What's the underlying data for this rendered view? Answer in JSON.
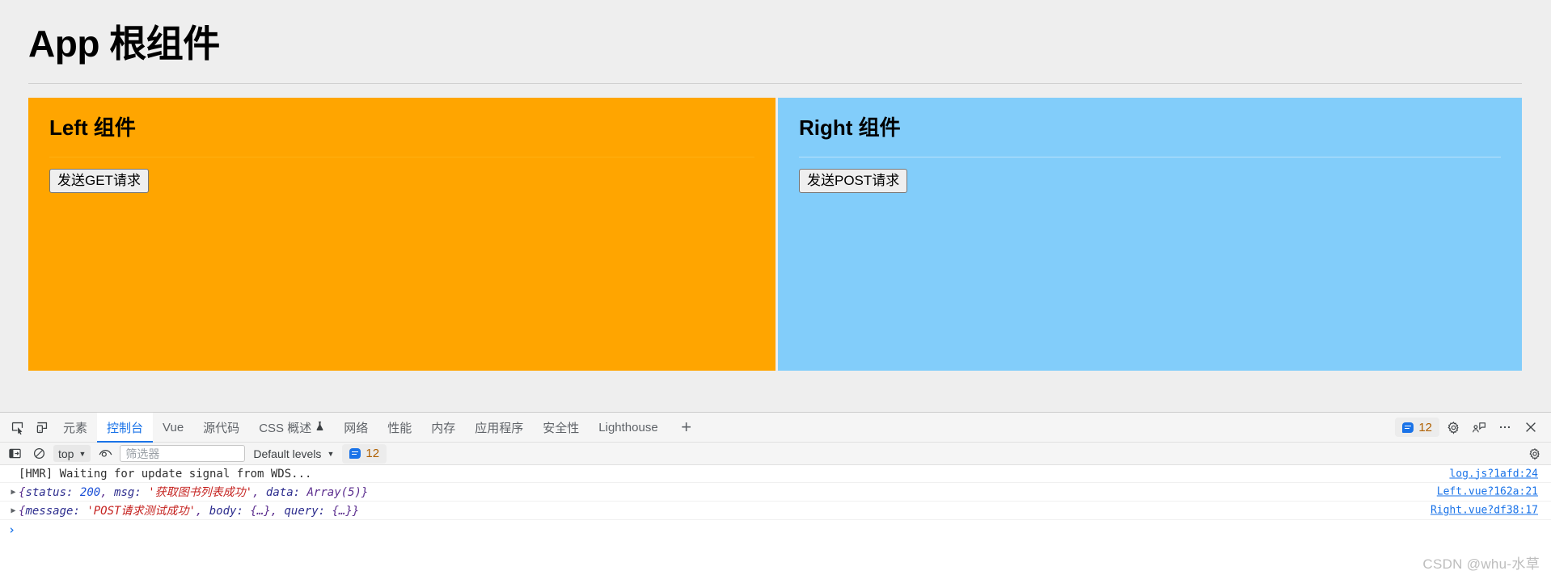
{
  "page": {
    "title": "App 根组件",
    "left_panel": {
      "heading": "Left 组件",
      "button_label": "发送GET请求",
      "bg_color": "#ffa500"
    },
    "right_panel": {
      "heading": "Right 组件",
      "button_label": "发送POST请求",
      "bg_color": "#82cdfa"
    }
  },
  "devtools": {
    "tabs": [
      {
        "label": "元素",
        "active": false,
        "icon": ""
      },
      {
        "label": "控制台",
        "active": true,
        "icon": ""
      },
      {
        "label": "Vue",
        "active": false,
        "icon": ""
      },
      {
        "label": "源代码",
        "active": false,
        "icon": ""
      },
      {
        "label": "CSS 概述",
        "active": false,
        "icon": "beaker-icon"
      },
      {
        "label": "网络",
        "active": false,
        "icon": ""
      },
      {
        "label": "性能",
        "active": false,
        "icon": ""
      },
      {
        "label": "内存",
        "active": false,
        "icon": ""
      },
      {
        "label": "应用程序",
        "active": false,
        "icon": ""
      },
      {
        "label": "安全性",
        "active": false,
        "icon": ""
      },
      {
        "label": "Lighthouse",
        "active": false,
        "icon": ""
      }
    ],
    "add_tab_label": "+",
    "message_badge_count": "12",
    "accent_color": "#1a73e8",
    "console_toolbar": {
      "context": "top",
      "filter_placeholder": "筛选器",
      "filter_value": "",
      "levels": "Default levels",
      "badge_count": "12"
    },
    "console_logs": [
      {
        "expandable": false,
        "text": "[HMR] Waiting for update signal from WDS...",
        "source": "log.js?1afd:24",
        "tokens": []
      },
      {
        "expandable": true,
        "text": "{status: 200, msg: '获取图书列表成功', data: Array(5)}",
        "source": "Left.vue?162a:21",
        "tokens": [
          {
            "t": "{",
            "c": "pun"
          },
          {
            "t": "status:",
            "c": "key"
          },
          {
            "t": " ",
            "c": "pun"
          },
          {
            "t": "200",
            "c": "num"
          },
          {
            "t": ", ",
            "c": "pun"
          },
          {
            "t": "msg:",
            "c": "key"
          },
          {
            "t": " ",
            "c": "pun"
          },
          {
            "t": "'获取图书列表成功'",
            "c": "str"
          },
          {
            "t": ", ",
            "c": "pun"
          },
          {
            "t": "data:",
            "c": "key"
          },
          {
            "t": " Array(5)}",
            "c": "pun"
          }
        ]
      },
      {
        "expandable": true,
        "text": "{message: 'POST请求测试成功', body: {…}, query: {…}}",
        "source": "Right.vue?df38:17",
        "tokens": [
          {
            "t": "{",
            "c": "pun"
          },
          {
            "t": "message:",
            "c": "key"
          },
          {
            "t": " ",
            "c": "pun"
          },
          {
            "t": "'POST请求测试成功'",
            "c": "str"
          },
          {
            "t": ", ",
            "c": "pun"
          },
          {
            "t": "body:",
            "c": "key"
          },
          {
            "t": " {…}, ",
            "c": "pun"
          },
          {
            "t": "query:",
            "c": "key"
          },
          {
            "t": " {…}}",
            "c": "pun"
          }
        ]
      }
    ],
    "prompt_symbol": "›"
  },
  "watermark": "CSDN @whu-水草"
}
